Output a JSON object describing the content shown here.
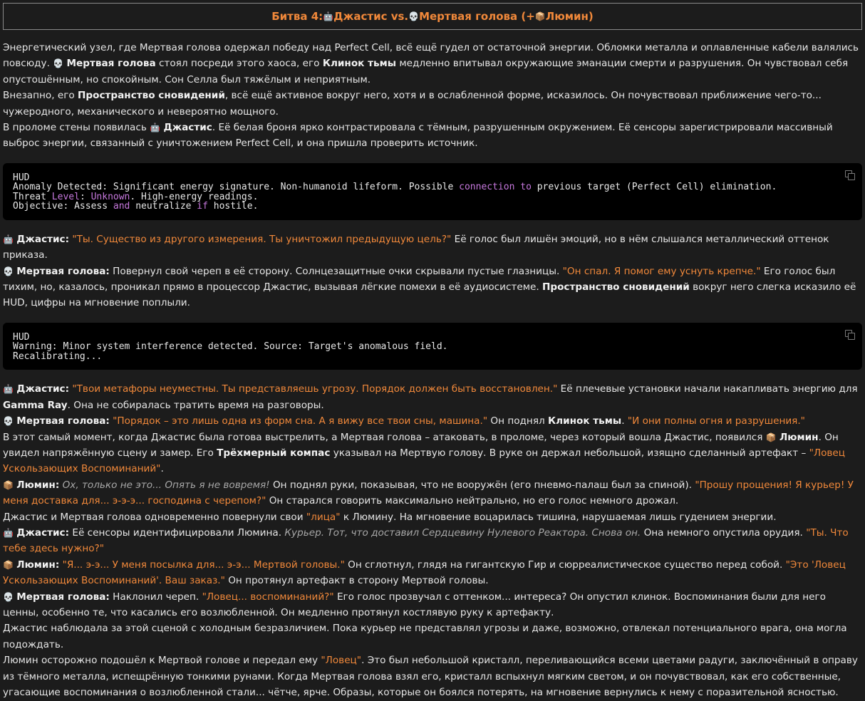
{
  "title": {
    "prefix": "Битва 4: ",
    "icon_a": "🤖",
    "name_a": " Джастис vs. ",
    "icon_b": "💀",
    "name_b": " Мертвая голова (+",
    "icon_c": "📦",
    "name_c": "Люмин)"
  },
  "icons": {
    "justice": "🤖",
    "deadhead": "💀",
    "lumin": "📦"
  },
  "p1": {
    "t1": "Энергетический узел, где Мертвая голова одержал победу над Perfect Cell, всё ещё гудел от остаточной энергии. Обломки металла и оплавленные кабели валялись повсюду. ",
    "deadhead": "Мертвая голова",
    "t2": " стоял посреди этого хаоса, его ",
    "blade": "Клинок тьмы",
    "t3": " медленно впитывал окружающие эманации смерти и разрушения. Он чувствовал себя опустошённым, но спокойным. Сон Селла был тяжёлым и неприятным."
  },
  "p2": {
    "t1": "Внезапно, его ",
    "dream": "Пространство сновидений",
    "t2": ", всё ещё активное вокруг него, хотя и в ослабленной форме, исказилось. Он почувствовал приближение чего-то... чужеродного, механического и невероятно мощного."
  },
  "p3": {
    "t1": "В проломе стены появилась ",
    "justice": "Джастис",
    "t2": ". Её белая броня ярко контрастировала с тёмным, разрушенным окружением. Её сенсоры зарегистрировали массивный выброс энергии, связанный с уничтожением Perfect Cell, и она пришла проверить источник."
  },
  "code1": {
    "l1": "HUD",
    "l2a": "Anomaly Detected: Significant energy signature. Non-humanoid lifeform. Possible ",
    "l2k1": "connection",
    "l2b": " ",
    "l2k2": "to",
    "l2c": " previous target (Perfect Cell) elimination.",
    "l3a": "Threat ",
    "l3k1": "Level",
    "l3b": ": ",
    "l3k2": "Unknown",
    "l3c": ". High-energy readings.",
    "l4a": "Objective: Assess ",
    "l4k1": "and",
    "l4b": " neutralize ",
    "l4k2": "if",
    "l4c": " hostile."
  },
  "d1": {
    "speaker": "Джастис:",
    "quote": "\"Ты. Существо из другого измерения. Ты уничтожил предыдущую цель?\"",
    "t1": " Её голос был лишён эмоций, но в нём слышался металлический оттенок приказа."
  },
  "d2": {
    "speaker": "Мертвая голова:",
    "t1": " Повернул свой череп в её сторону. Солнцезащитные очки скрывали пустые глазницы. ",
    "quote": "\"Он спал. Я помог ему уснуть крепче.\"",
    "t2": " Его голос был тихим, но, казалось, проникал прямо в процессор Джастис, вызывая лёгкие помехи в её аудиосистеме. ",
    "dream": "Пространство сновидений",
    "t3": " вокруг него слегка исказило её HUD, цифры на мгновение поплыли."
  },
  "code2": {
    "l1": "HUD",
    "l2": "Warning: Minor system interference detected. Source: Target's anomalous field.",
    "l3": "Recalibrating..."
  },
  "d3": {
    "speaker": "Джастис:",
    "quote": "\"Твои метафоры неуместны. Ты представляешь угрозу. Порядок должен быть восстановлен.\"",
    "t1": " Её плечевые установки начали накапливать энергию для ",
    "gamma": "Gamma Ray",
    "t2": ". Она не собиралась тратить время на разговоры."
  },
  "d4": {
    "speaker": "Мертвая голова:",
    "quote1": "\"Порядок – это лишь одна из форм сна. А я вижу все твои сны, машина.\"",
    "t1": " Он поднял ",
    "blade": "Клинок тьмы",
    "t2": ". ",
    "quote2": "\"И они полны огня и разрушения.\""
  },
  "p4": {
    "t1": "В этот самый момент, когда Джастис была готова выстрелить, а Мертвая голова – атаковать, в проломе, через который вошла Джастис, появился ",
    "lumin": "Люмин",
    "t2": ". Он увидел напряжённую сцену и замер. Его ",
    "compass": "Трёхмерный компас",
    "t3": " указывал на Мертвую голову. В руке он держал небольшой, изящно сделанный артефакт – ",
    "artifact": "\"Ловец Ускользающих Воспоминаний\"",
    "t4": "."
  },
  "d5": {
    "speaker": "Люмин:",
    "italic": "Ох, только не это... Опять я не вовремя!",
    "t1": " Он поднял руки, показывая, что не вооружён (его пневмо-палаш был за спиной). ",
    "quote": "\"Прошу прощения! Я курьер! У меня доставка для... э-э-э... господина с черепом?\"",
    "t2": " Он старался говорить максимально нейтрально, но его голос немного дрожал."
  },
  "p5": {
    "t1": "Джастис и Мертвая голова одновременно повернули свои ",
    "quote": "\"лица\"",
    "t2": " к Люмину. На мгновение воцарилась тишина, нарушаемая лишь гудением энергии."
  },
  "d6": {
    "speaker": "Джастис:",
    "t1": " Её сенсоры идентифицировали Люмина. ",
    "italic": "Курьер. Тот, что доставил Сердцевину Нулевого Реактора. Снова он.",
    "t2": " Она немного опустила орудия. ",
    "quote": "\"Ты. Что тебе здесь нужно?\""
  },
  "d7": {
    "speaker": "Люмин:",
    "quote1": "\"Я... э-э... У меня посылка для... э-э... Мертвой головы.\"",
    "t1": " Он сглотнул, глядя на гигантскую Гир и сюрреалистическое существо перед собой. ",
    "quote2": "\"Это 'Ловец Ускользающих Воспоминаний'. Ваш заказ.\"",
    "t2": " Он протянул артефакт в сторону Мертвой головы."
  },
  "d8": {
    "speaker": "Мертвая голова:",
    "t1": " Наклонил череп. ",
    "quote": "\"Ловец... воспоминаний?\"",
    "t2": " Его голос прозвучал с оттенком... интереса? Он опустил клинок. Воспоминания были для него ценны, особенно те, что касались его возлюбленной. Он медленно протянул костлявую руку к артефакту."
  },
  "p6": {
    "t1": "Джастис наблюдала за этой сценой с холодным безразличием. Пока курьер не представлял угрозы и даже, возможно, отвлекал потенциального врага, она могла подождать."
  },
  "p7": {
    "t1": "Люмин осторожно подошёл к Мертвой голове и передал ему ",
    "quote": "\"Ловец\"",
    "t2": ". Это был небольшой кристалл, переливающийся всеми цветами радуги, заключённый в оправу из тёмного металла, испещрённую тонкими рунами. Когда Мертвая голова взял его, кристалл вспыхнул мягким светом, и он почувствовал, как его собственные, угасающие воспоминания о возлюбленной стали... чётче, ярче. Образы, которые он боялся потерять, на мгновение вернулись к нему с поразительной ясностью."
  }
}
